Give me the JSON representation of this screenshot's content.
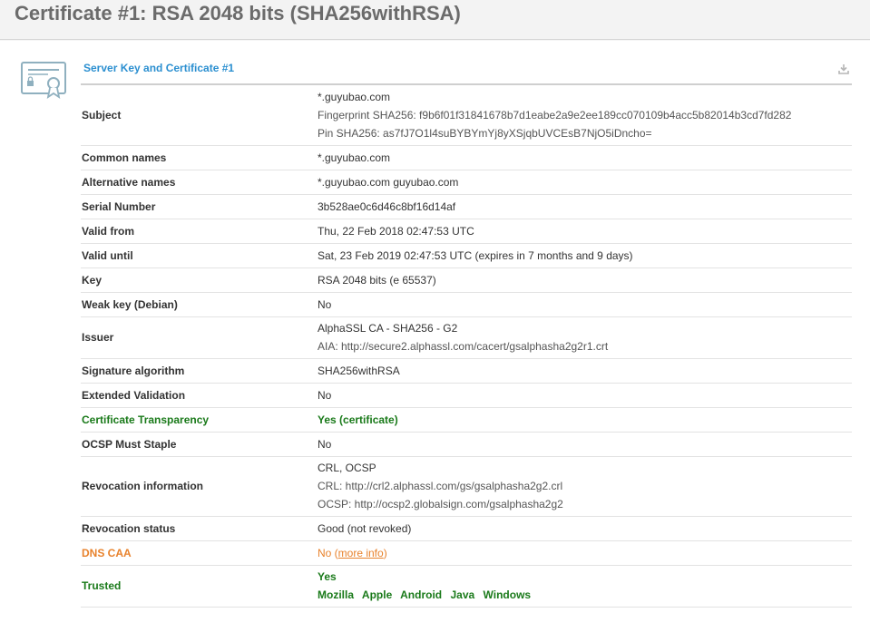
{
  "page_title": "Certificate #1: RSA 2048 bits (SHA256withRSA)",
  "section_title": "Server Key and Certificate #1",
  "rows": {
    "subject": {
      "label": "Subject",
      "value": "*.guyubao.com",
      "fingerprint": "Fingerprint SHA256: f9b6f01f31841678b7d1eabe2a9e2ee189cc070109b4acc5b82014b3cd7fd282",
      "pin": "Pin SHA256: as7fJ7O1l4suBYBYmYj8yXSjqbUVCEsB7NjO5iDncho="
    },
    "common_names": {
      "label": "Common names",
      "value": "*.guyubao.com"
    },
    "alt_names": {
      "label": "Alternative names",
      "value": "*.guyubao.com guyubao.com"
    },
    "serial": {
      "label": "Serial Number",
      "value": "3b528ae0c6d46c8bf16d14af"
    },
    "valid_from": {
      "label": "Valid from",
      "value": "Thu, 22 Feb 2018 02:47:53 UTC"
    },
    "valid_until": {
      "label": "Valid until",
      "value": "Sat, 23 Feb 2019 02:47:53 UTC (expires in 7 months and 9 days)"
    },
    "key": {
      "label": "Key",
      "value": "RSA 2048 bits (e 65537)"
    },
    "weak_key": {
      "label": "Weak key (Debian)",
      "value": "No"
    },
    "issuer": {
      "label": "Issuer",
      "value": "AlphaSSL CA - SHA256 - G2",
      "aia": "AIA: http://secure2.alphassl.com/cacert/gsalphasha2g2r1.crt"
    },
    "sig_alg": {
      "label": "Signature algorithm",
      "value": "SHA256withRSA"
    },
    "ev": {
      "label": "Extended Validation",
      "value": "No"
    },
    "ct": {
      "label": "Certificate Transparency",
      "value": "Yes (certificate)"
    },
    "ocsp_staple": {
      "label": "OCSP Must Staple",
      "value": "No"
    },
    "revocation_info": {
      "label": "Revocation information",
      "value": "CRL, OCSP",
      "crl": "CRL: http://crl2.alphassl.com/gs/gsalphasha2g2.crl",
      "ocsp": "OCSP: http://ocsp2.globalsign.com/gsalphasha2g2"
    },
    "revocation_status": {
      "label": "Revocation status",
      "value": "Good (not revoked)"
    },
    "dns_caa": {
      "label": "DNS CAA",
      "value_prefix": "No (",
      "link": "more info",
      "value_suffix": ")"
    },
    "trusted": {
      "label": "Trusted",
      "value": "Yes",
      "stores": [
        "Mozilla",
        "Apple",
        "Android",
        "Java",
        "Windows"
      ]
    }
  },
  "colors": {
    "accent": "#2b8fd0",
    "green": "#1a7a1a",
    "warning": "#e8822c"
  },
  "icons": {
    "certificate": "certificate-icon",
    "download": "download-icon"
  }
}
